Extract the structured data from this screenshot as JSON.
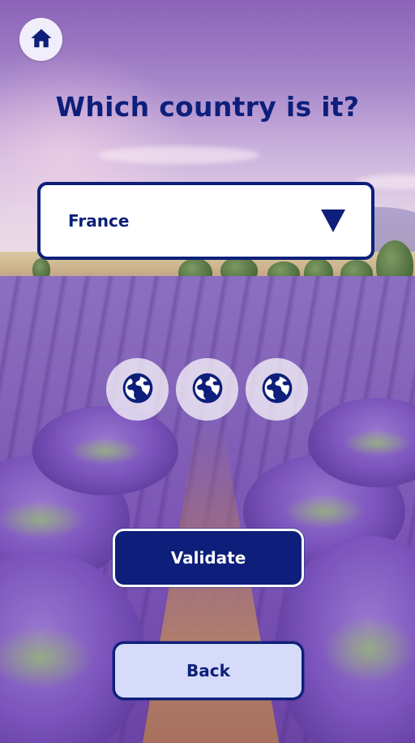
{
  "header": {
    "home_icon": "home-icon"
  },
  "quiz": {
    "question": "Which country is it?",
    "selected_country": "France",
    "dropdown_icon": "triangle-down-icon",
    "hint_icons": [
      "globe-icon",
      "globe-icon",
      "globe-icon"
    ]
  },
  "actions": {
    "validate_label": "Validate",
    "back_label": "Back"
  },
  "colors": {
    "primary": "#0d1f7a",
    "secondary_button_bg": "#d5dbf8",
    "hint_bg": "#ffffffb8"
  }
}
